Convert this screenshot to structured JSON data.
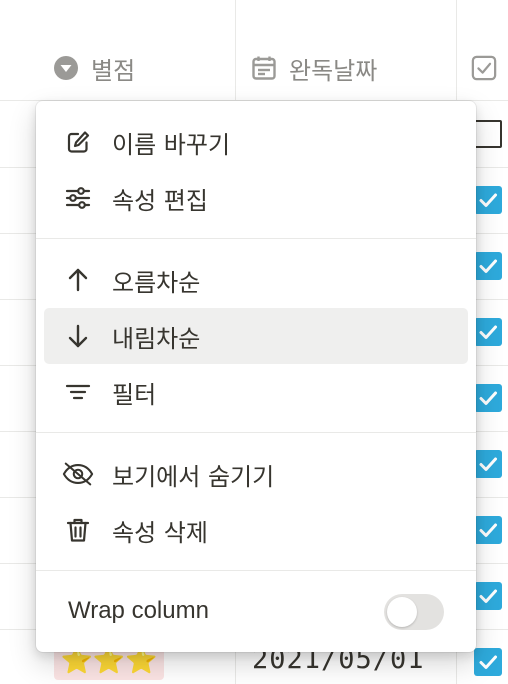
{
  "table": {
    "columns": [
      {
        "label": "별점",
        "icon": "select-caret-icon"
      },
      {
        "label": "완독날짜",
        "icon": "calendar-icon"
      },
      {
        "label": "",
        "icon": "checkbox-icon"
      }
    ],
    "visible_last_row": {
      "rating": "⭐⭐⭐",
      "date": "2021/05/01"
    },
    "checkbox_states": [
      false,
      true,
      true,
      true,
      true,
      true,
      true,
      true,
      true
    ]
  },
  "menu": {
    "items_group1": [
      {
        "label": "이름 바꾸기",
        "icon": "edit-icon"
      },
      {
        "label": "속성 편집",
        "icon": "sliders-icon"
      }
    ],
    "items_group2": [
      {
        "label": "오름차순",
        "icon": "arrow-up-icon"
      },
      {
        "label": "내림차순",
        "icon": "arrow-down-icon"
      },
      {
        "label": "필터",
        "icon": "filter-icon"
      }
    ],
    "items_group3": [
      {
        "label": "보기에서 숨기기",
        "icon": "eye-off-icon"
      },
      {
        "label": "속성 삭제",
        "icon": "trash-icon"
      }
    ],
    "wrap_column": {
      "label": "Wrap column",
      "enabled": false
    }
  },
  "colors": {
    "accent": "#2eaadc",
    "text": "#37352f",
    "muted": "#8a8985",
    "hover": "#efefee",
    "rating_bg": "#fbe4e4"
  }
}
